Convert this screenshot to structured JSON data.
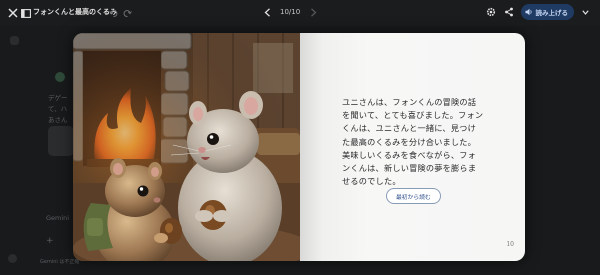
{
  "topbar": {
    "title": "フォンくんと最高のくるみ",
    "page_indicator": "10/10",
    "read_aloud_label": "読み上げる",
    "close_icon": "close-icon",
    "sidebar_icon": "sidebar-panel-icon",
    "undo_icon": "undo-icon",
    "redo_icon": "redo-icon"
  },
  "background": {
    "snippets": [
      "デゲー",
      "て、ハ",
      "あさん",
      "Gemini",
      "Gemini は不正確"
    ]
  },
  "book": {
    "story_text": "ユニさんは、フォンくんの冒険の話を聞いて、とても喜びました。フォンくんは、ユニさんと一緒に、見つけた最高のくるみを分け合いました。美味しいくるみを食べながら、フォンくんは、新しい冒険の夢を膨らませるのでした。",
    "restart_label": "最初から読む",
    "page_number": "10"
  },
  "colors": {
    "topbar_bg": "#1b1c1d",
    "accent_button": "#1f3b63",
    "page_bg": "#f6f6f5"
  }
}
